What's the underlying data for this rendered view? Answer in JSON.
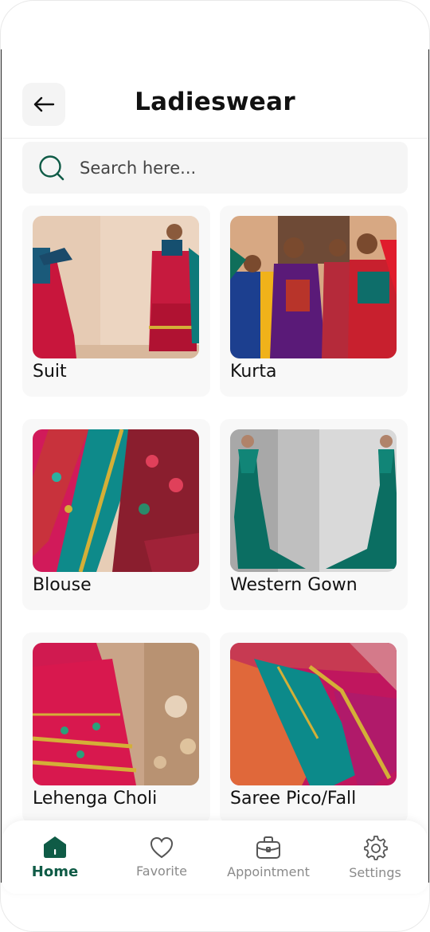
{
  "header": {
    "title": "Ladieswear"
  },
  "search": {
    "placeholder": "Search here..."
  },
  "categories": [
    {
      "label": "Suit"
    },
    {
      "label": "Kurta"
    },
    {
      "label": "Blouse"
    },
    {
      "label": "Western Gown"
    },
    {
      "label": "Lehenga Choli"
    },
    {
      "label": "Saree Pico/Fall"
    }
  ],
  "nav": {
    "items": [
      {
        "label": "Home",
        "icon": "home-icon",
        "active": true
      },
      {
        "label": "Favorite",
        "icon": "heart-icon",
        "active": false
      },
      {
        "label": "Appointment",
        "icon": "briefcase-icon",
        "active": false
      },
      {
        "label": "Settings",
        "icon": "gear-icon",
        "active": false
      }
    ]
  },
  "colors": {
    "accent": "#0f5b46",
    "inactive": "#8a8a8a",
    "card_bg": "#f8f8f8"
  }
}
